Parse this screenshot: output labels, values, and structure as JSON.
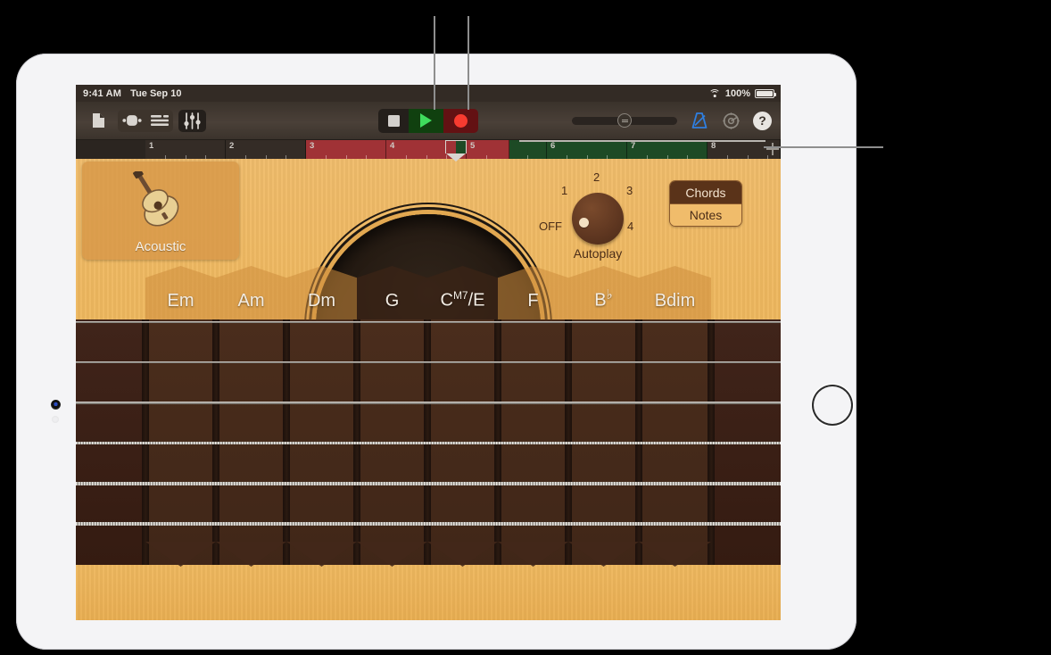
{
  "status_bar": {
    "time": "9:41 AM",
    "date": "Tue Sep 10",
    "battery_percent": "100%",
    "wifi_icon": "wifi-icon",
    "battery_icon": "battery-icon"
  },
  "toolbar": {
    "left_buttons": [
      {
        "name": "my-songs-button",
        "icon": "document-icon"
      },
      {
        "name": "loop-browser-button",
        "icon": "loop-browser-icon"
      },
      {
        "name": "track-view-button",
        "icon": "track-view-icon"
      },
      {
        "name": "mixer-button",
        "icon": "mixer-faders-icon"
      }
    ],
    "transport": [
      {
        "name": "stop-button",
        "icon": "stop-icon"
      },
      {
        "name": "play-button",
        "icon": "play-icon"
      },
      {
        "name": "record-button",
        "icon": "record-icon"
      }
    ],
    "master_volume_label": "master-volume-slider",
    "metronome_icon": "metronome-icon",
    "settings_icon": "gear-icon",
    "help_label": "?"
  },
  "ruler": {
    "bars": [
      {
        "label": "1",
        "state": "dark"
      },
      {
        "label": "2",
        "state": "dark"
      },
      {
        "label": "3",
        "state": "red"
      },
      {
        "label": "4",
        "state": "red"
      },
      {
        "label": "5",
        "state": "red"
      },
      {
        "label": "6",
        "state": "green"
      },
      {
        "label": "7",
        "state": "green"
      },
      {
        "label": "8",
        "state": "tail"
      }
    ],
    "playhead_bar": "5",
    "add_section_label": "+",
    "add_section_icon": "plus-icon"
  },
  "instrument": {
    "picker": {
      "label": "Acoustic",
      "icon": "acoustic-guitar-icon"
    },
    "autoplay": {
      "title": "Autoplay",
      "off_label": "OFF",
      "positions": [
        "1",
        "2",
        "3",
        "4"
      ],
      "selected": "OFF"
    },
    "mode_toggle": {
      "chords_label": "Chords",
      "notes_label": "Notes",
      "selected": "Chords"
    },
    "chords": [
      {
        "root": "Em",
        "sup": "",
        "flat": ""
      },
      {
        "root": "Am",
        "sup": "",
        "flat": ""
      },
      {
        "root": "Dm",
        "sup": "",
        "flat": ""
      },
      {
        "root": "G",
        "sup": "",
        "flat": ""
      },
      {
        "root": "C",
        "sup": "M7",
        "suffix": "/E",
        "flat": ""
      },
      {
        "root": "F",
        "sup": "",
        "flat": ""
      },
      {
        "root": "B",
        "sup": "",
        "flat": "♭"
      },
      {
        "root": "Bdim",
        "sup": "",
        "flat": ""
      }
    ]
  },
  "colors": {
    "wood": "#eeb85f",
    "fretboard": "#4a2d1c",
    "record_red": "#f83b30",
    "play_green": "#3fdc5d",
    "ruler_red": "#a03236",
    "ruler_green": "#1d4a25",
    "metronome_blue": "#2f7fe0"
  }
}
